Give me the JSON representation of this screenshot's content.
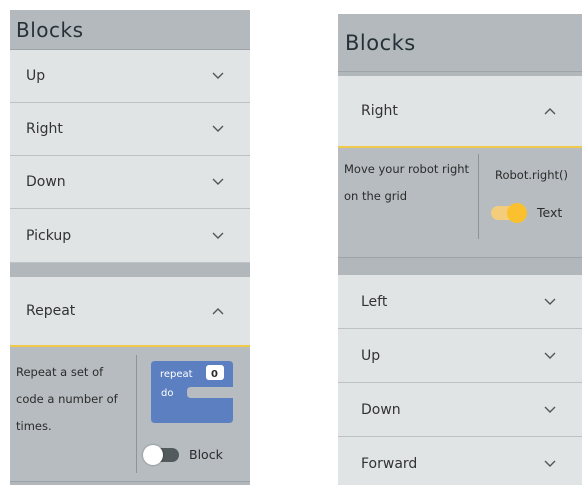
{
  "left": {
    "title": "Blocks",
    "items": [
      {
        "label": "Up"
      },
      {
        "label": "Right"
      },
      {
        "label": "Down"
      },
      {
        "label": "Pickup"
      }
    ],
    "open_item": {
      "label": "Repeat",
      "description": "Repeat a set of code a number of times.",
      "block": {
        "keyword": "repeat",
        "count": "0",
        "body": "do"
      },
      "toggle_label": "Block",
      "toggle_on": false
    }
  },
  "right": {
    "title": "Blocks",
    "open_item": {
      "label": "Right",
      "description": "Move your robot right on the grid",
      "code": "Robot.right()",
      "toggle_label": "Text",
      "toggle_on": true
    },
    "items": [
      {
        "label": "Left"
      },
      {
        "label": "Up"
      },
      {
        "label": "Down"
      },
      {
        "label": "Forward"
      }
    ]
  },
  "colors": {
    "accent_yellow": "#f0c94b",
    "block_blue": "#5b7fc0",
    "panel_bg": "#b1b7bb",
    "item_bg": "#e1e4e5"
  },
  "icons": {
    "collapsed": "chevron-down-icon",
    "expanded": "chevron-up-icon"
  }
}
